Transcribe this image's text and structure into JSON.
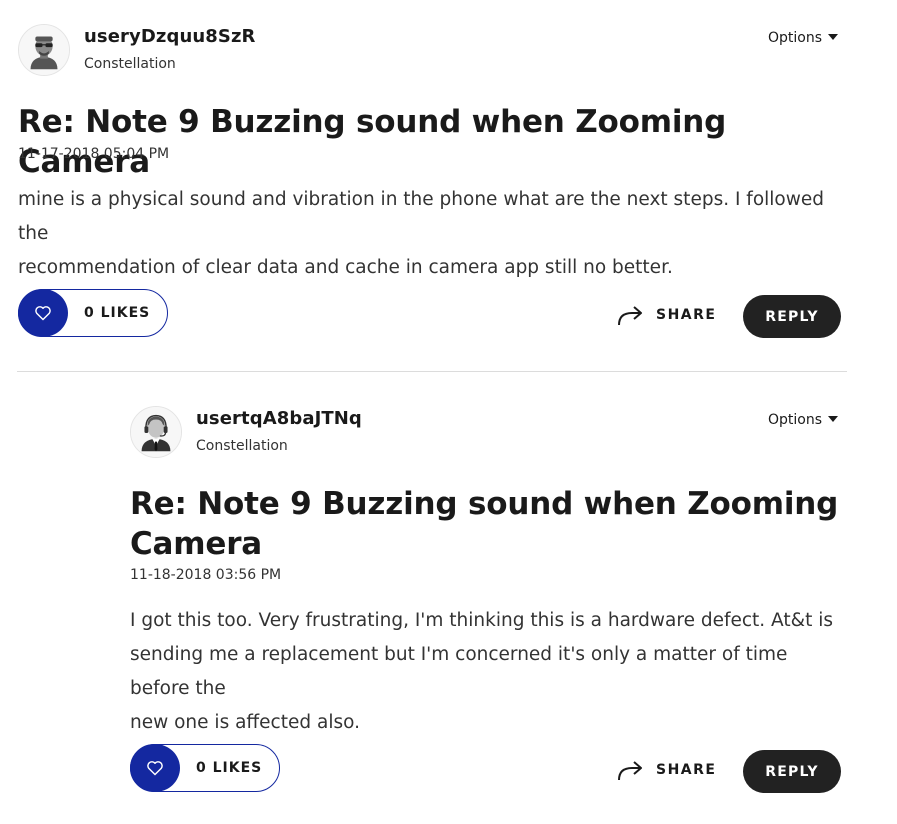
{
  "posts": [
    {
      "username": "useryDzquu8SzR",
      "rank": "Constellation",
      "options_label": "Options",
      "title": "Re: Note 9 Buzzing sound when Zooming Camera",
      "date": "11-17-2018 05:04 PM",
      "body_lines": [
        "mine is a physical sound and vibration in the phone what are the next steps.  I followed the",
        "recommendation  of clear data and cache in camera app still no better."
      ],
      "likes_label": "0 LIKES",
      "share_label": "SHARE",
      "reply_label": "REPLY"
    },
    {
      "username": "usertqA8baJTNq",
      "rank": "Constellation",
      "options_label": "Options",
      "title_lines": [
        "Re: Note 9 Buzzing sound when Zooming",
        "Camera"
      ],
      "date": "11-18-2018 03:56 PM",
      "body_lines": [
        "I got this too. Very frustrating, I'm thinking this is a hardware defect. At&t is",
        "sending me a replacement but I'm concerned it's only a matter of time before the",
        "new one is affected also."
      ],
      "likes_label": "0 LIKES",
      "share_label": "SHARE",
      "reply_label": "REPLY"
    }
  ],
  "colors": {
    "like_accent": "#1428a0",
    "reply_bg": "#222222",
    "divider": "#dcdcdc"
  },
  "icons": {
    "like": "heart-icon",
    "share": "share-arrow-icon",
    "options": "caret-down-icon",
    "avatar_1": "sunglasses-avatar-icon",
    "avatar_2": "headset-avatar-icon"
  }
}
